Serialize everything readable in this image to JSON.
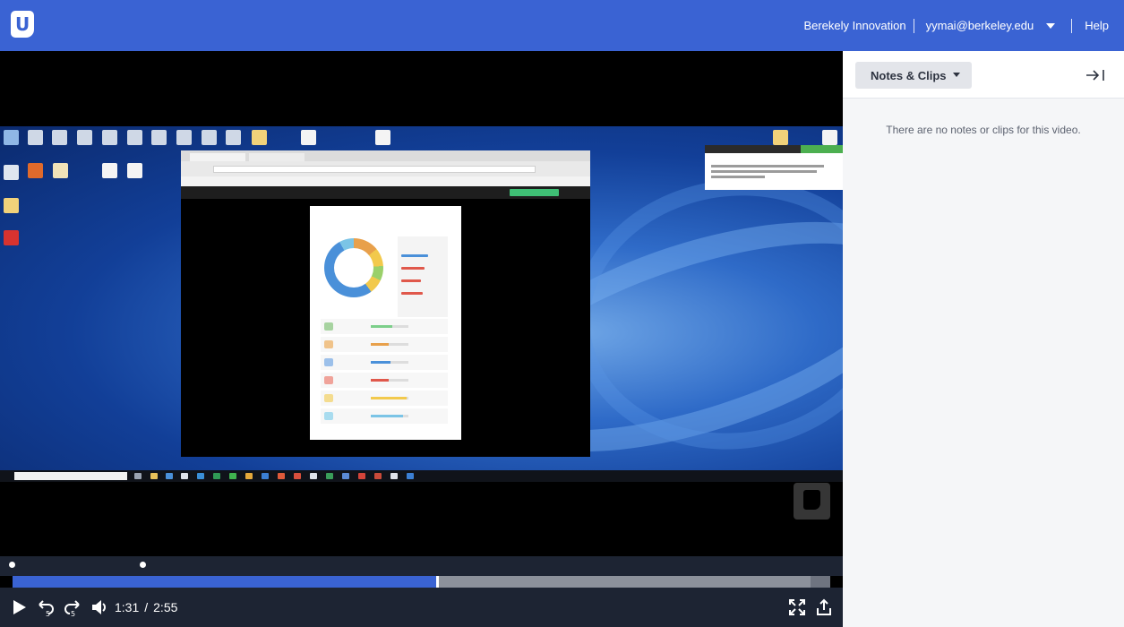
{
  "topbar": {
    "logo_letter": "U",
    "org": "Berekely Innovation",
    "email": "yymai@berkeley.edu",
    "help": "Help"
  },
  "player": {
    "current_time": "1:31",
    "separator": "/",
    "duration": "2:55",
    "played_fraction": 0.519,
    "buffered_fraction": 0.976
  },
  "panel": {
    "dropdown_label": "Notes & Clips",
    "empty_message": "There are no notes or clips for this video."
  },
  "icons": [
    "logo-icon",
    "chevron-down-icon",
    "play-icon",
    "rewind-5-icon",
    "forward-5-icon",
    "volume-icon",
    "fullscreen-icon",
    "share-icon",
    "collapse-panel-icon"
  ],
  "colors": {
    "brand_blue": "#3a63d3",
    "control_bar": "#1d2433",
    "panel_bg": "#f5f6f8"
  }
}
